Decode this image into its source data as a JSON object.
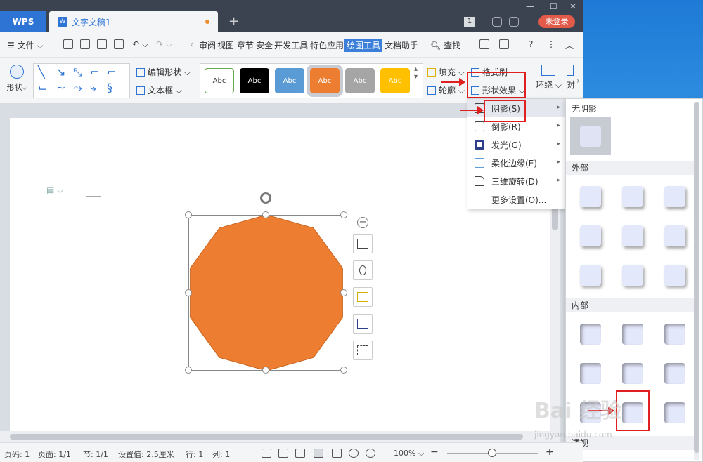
{
  "app": {
    "name": "WPS",
    "doc_tab": "文字文稿1",
    "doc_icon": "W",
    "page_counter": "1",
    "login": "未登录"
  },
  "menu": {
    "file": "文件",
    "tabs": [
      "审阅",
      "视图",
      "章节",
      "安全",
      "开发工具",
      "特色应用",
      "绘图工具",
      "文档助手"
    ],
    "search": "查找"
  },
  "ribbon": {
    "shape": "形状",
    "edit_shape": "编辑形状",
    "textbox": "文本框",
    "style_label": "Abc",
    "fill": "填充",
    "outline": "轮廓",
    "format_brush": "格式刷",
    "shape_effect": "形状效果",
    "wrap": "环绕",
    "align": "对"
  },
  "styles": [
    {
      "label": "Abc",
      "bg": "#ffffff",
      "fg": "#333333",
      "border": "#6aa84f"
    },
    {
      "label": "Abc",
      "bg": "#000000",
      "fg": "#ffffff",
      "border": "#000000"
    },
    {
      "label": "Abc",
      "bg": "#5b9bd5",
      "fg": "#ffffff",
      "border": "#5b9bd5"
    },
    {
      "label": "Abc",
      "bg": "#ed7d31",
      "fg": "#ffffff",
      "border": "#ed7d31"
    },
    {
      "label": "Abc",
      "bg": "#a5a5a5",
      "fg": "#ffffff",
      "border": "#a5a5a5"
    },
    {
      "label": "Abc",
      "bg": "#ffc000",
      "fg": "#ffffff",
      "border": "#ffc000"
    }
  ],
  "dropdown": {
    "items": [
      "阴影(S)",
      "倒影(R)",
      "发光(G)",
      "柔化边缘(E)",
      "三维旋转(D)",
      "更多设置(O)..."
    ]
  },
  "submenu": {
    "no_shadow": "无阴影",
    "outer": "外部",
    "inner": "内部",
    "perspective": "透视"
  },
  "status": {
    "page_code": "页码: 1",
    "page": "页面: 1/1",
    "section": "节: 1/1",
    "setting": "设置值: 2.5厘米",
    "row": "行: 1",
    "col": "列: 1",
    "zoom": "100%"
  },
  "watermark": {
    "text": "Bai 经验",
    "sub": "jingyan.baidu.com"
  },
  "colors": {
    "shape_fill": "#ed7d31",
    "accent": "#2d74d5",
    "highlight": "#e02020"
  }
}
